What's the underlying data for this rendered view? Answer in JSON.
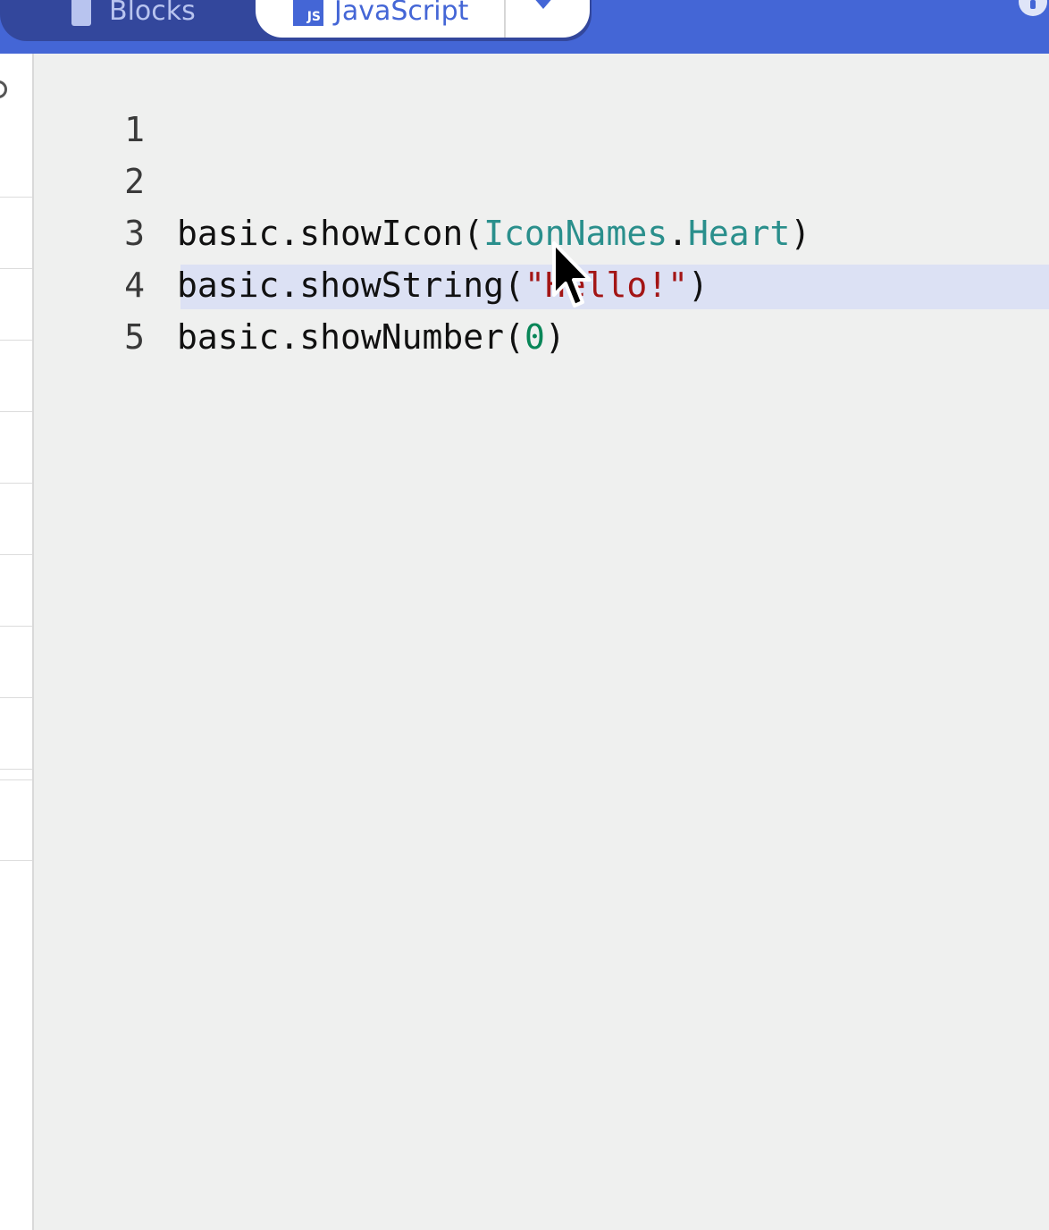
{
  "header": {
    "tabs": [
      {
        "label": "Blocks",
        "active": false
      },
      {
        "label": "JavaScript",
        "active": true,
        "icon_text": "JS"
      }
    ],
    "more_icon": "chevron-down-icon",
    "corner_icon": "info-icon",
    "colors": {
      "bar": "#4466d6",
      "toggle": "#33479c",
      "active_tab": "#ffffff"
    }
  },
  "editor": {
    "lines": [
      {
        "num": "1",
        "tokens": []
      },
      {
        "num": "2",
        "tokens": [
          {
            "t": "basic.showIcon(",
            "k": "plain"
          },
          {
            "t": "IconNames",
            "k": "type"
          },
          {
            "t": ".",
            "k": "plain"
          },
          {
            "t": "Heart",
            "k": "type"
          },
          {
            "t": ")",
            "k": "plain"
          }
        ]
      },
      {
        "num": "3",
        "tokens": [
          {
            "t": "basic.showString(",
            "k": "plain"
          },
          {
            "t": "\"Hello!\"",
            "k": "str"
          },
          {
            "t": ")",
            "k": "plain"
          }
        ]
      },
      {
        "num": "4",
        "tokens": [
          {
            "t": "basic.showNumber(",
            "k": "plain"
          },
          {
            "t": "0",
            "k": "num"
          },
          {
            "t": ")",
            "k": "plain"
          }
        ]
      },
      {
        "num": "5",
        "tokens": []
      }
    ],
    "current_line": 5,
    "colors": {
      "type": "#2a8f8c",
      "string": "#a31515",
      "number": "#098658"
    }
  }
}
